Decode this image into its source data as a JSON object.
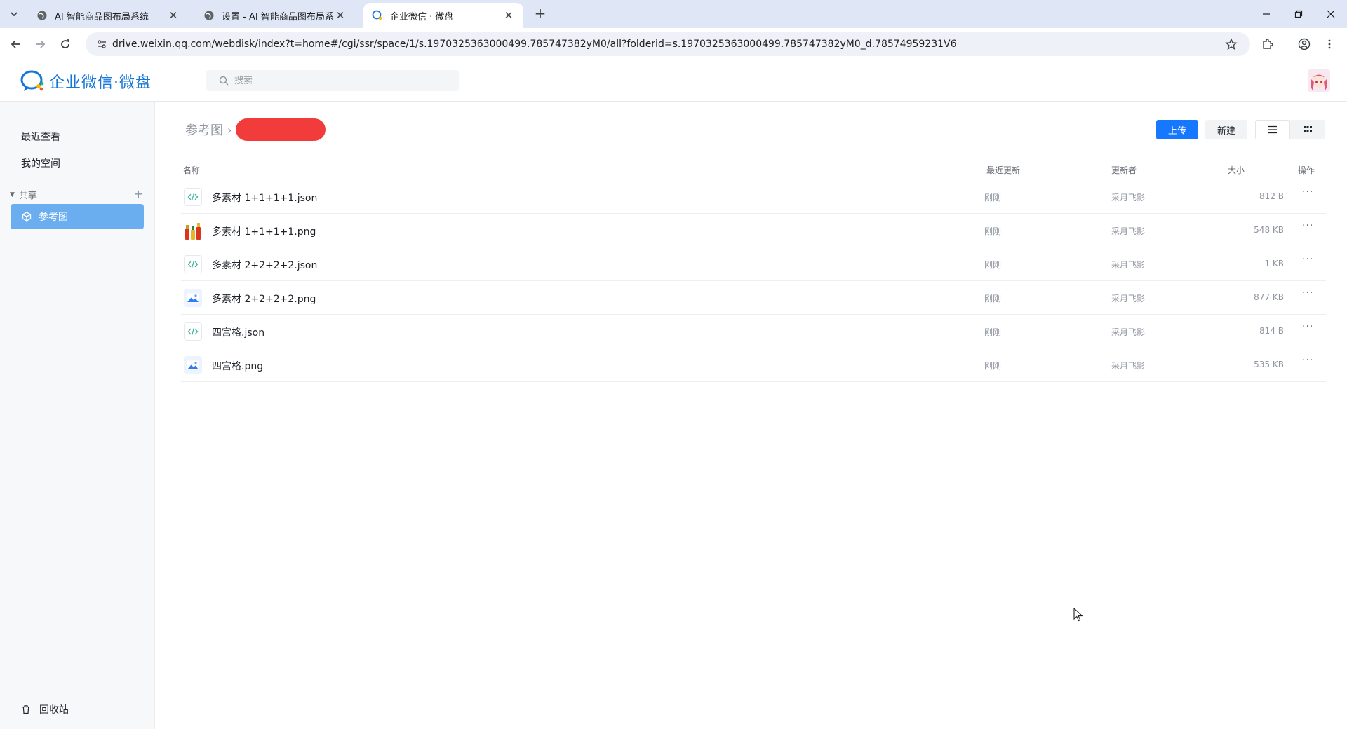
{
  "browser": {
    "tabs": [
      {
        "title": "AI 智能商品图布局系统",
        "active": false
      },
      {
        "title": "设置 - AI 智能商品图布局系统",
        "active": false
      },
      {
        "title": "企业微信 · 微盘",
        "active": true
      }
    ],
    "url": "drive.weixin.qq.com/webdisk/index?t=home#/cgi/ssr/space/1/s.1970325363000499.785747382yM0/all?folderid=s.1970325363000499.785747382yM0_d.78574959231V6"
  },
  "header": {
    "logo_text": "企业微信·微盘",
    "search_placeholder": "搜索"
  },
  "sidebar": {
    "recent": "最近查看",
    "my_space": "我的空间",
    "shared_group": "共享",
    "shared_items": [
      {
        "label": "参考图"
      }
    ],
    "trash": "回收站"
  },
  "breadcrumb": {
    "root": "参考图"
  },
  "toolbar": {
    "upload": "上传",
    "new": "新建"
  },
  "table": {
    "headers": {
      "name": "名称",
      "updated": "最近更新",
      "updater": "更新者",
      "size": "大小",
      "actions": "操作"
    },
    "rows": [
      {
        "name": "多素材 1+1+1+1.json",
        "type": "code",
        "updated": "刚刚",
        "updater": "采月飞影",
        "size": "812 B"
      },
      {
        "name": "多素材 1+1+1+1.png",
        "type": "thumb",
        "updated": "刚刚",
        "updater": "采月飞影",
        "size": "548 KB"
      },
      {
        "name": "多素材 2+2+2+2.json",
        "type": "code",
        "updated": "刚刚",
        "updater": "采月飞影",
        "size": "1 KB"
      },
      {
        "name": "多素材 2+2+2+2.png",
        "type": "image",
        "updated": "刚刚",
        "updater": "采月飞影",
        "size": "877 KB"
      },
      {
        "name": "四宫格.json",
        "type": "code",
        "updated": "刚刚",
        "updater": "采月飞影",
        "size": "814 B"
      },
      {
        "name": "四宫格.png",
        "type": "image",
        "updated": "刚刚",
        "updater": "采月飞影",
        "size": "535 KB"
      }
    ],
    "more_label": "···"
  },
  "colors": {
    "accent": "#1677ff",
    "sidebar_active": "#6aaef0",
    "redaction": "#f23c3c"
  }
}
